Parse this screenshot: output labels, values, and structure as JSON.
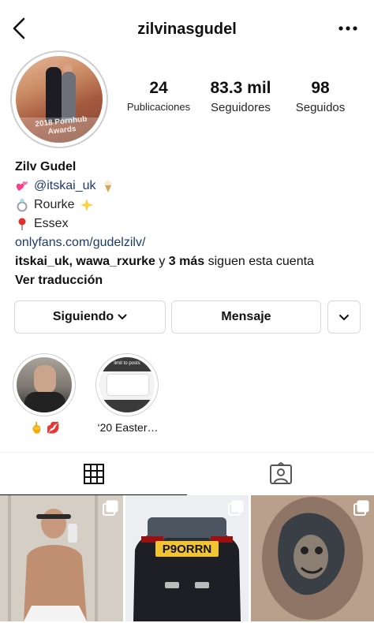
{
  "header": {
    "username": "zilvinasgudel"
  },
  "avatar": {
    "banner_text": "2018 Pornhub Awards"
  },
  "stats": {
    "posts": {
      "value": "24",
      "label": "Publicaciones"
    },
    "followers": {
      "value": "83.3 mil",
      "label": "Seguidores"
    },
    "following": {
      "value": "98",
      "label": "Seguidos"
    }
  },
  "bio": {
    "name": "Zilv Gudel",
    "lines": [
      {
        "icon": "two-hearts-icon",
        "text": "@itskai_uk",
        "trailing_icon": "ice-cream-icon"
      },
      {
        "icon": "ring-icon",
        "text": "Rourke",
        "trailing_icon": "glowing-star-icon"
      },
      {
        "icon": "pin-icon",
        "text": "Essex"
      }
    ],
    "link": "onlyfans.com/gudelzilv/",
    "followed_by": {
      "names": "itskai_uk, wawa_rxurke",
      "connector": "y",
      "more": "3 más",
      "suffix": "siguen esta cuenta"
    },
    "translate_label": "Ver traducción"
  },
  "buttons": {
    "following_label": "Siguiendo",
    "message_label": "Mensaje"
  },
  "highlights": [
    {
      "label": "🖕 💋"
    },
    {
      "label": "‘20 Easter…",
      "cover_caption": "limit to posts"
    }
  ],
  "tabs": [
    {
      "name": "grid",
      "icon": "grid-icon",
      "active": true
    },
    {
      "name": "tagged",
      "icon": "tagged-person-icon",
      "active": false
    }
  ],
  "posts": [
    {
      "type": "carousel",
      "icon": "multiple-posts-icon"
    },
    {
      "type": "carousel",
      "icon": "multiple-posts-icon",
      "plate_text": "P9ORRN"
    },
    {
      "type": "carousel",
      "icon": "multiple-posts-icon"
    }
  ],
  "colors": {
    "link": "#1c3a6e",
    "text": "#262626",
    "border": "#d9d9d9"
  }
}
